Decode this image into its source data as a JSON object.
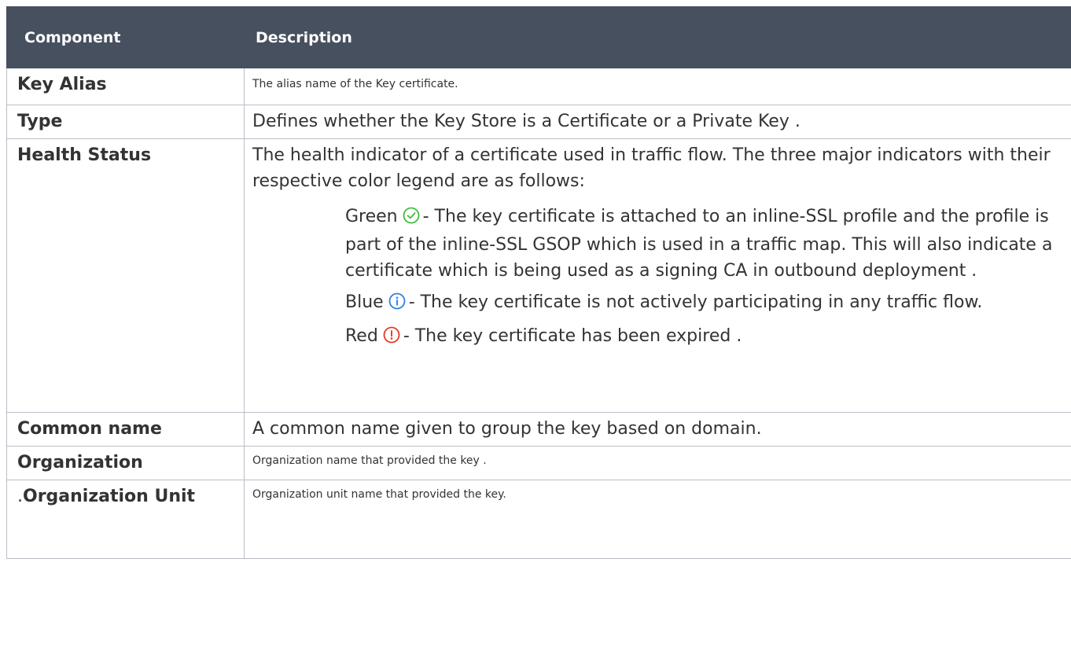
{
  "headers": {
    "component": "Component",
    "description": "Description"
  },
  "rows": [
    {
      "component": "Key Alias",
      "description": "The alias name of the Key certificate."
    },
    {
      "component": "Type",
      "description": "Defines whether the Key Store is a Certificate or a Private Key ."
    },
    {
      "component": "Health Status",
      "description": "The health indicator of a certificate used in traffic flow. The three major indicators with their respective color legend are as follows:",
      "indicators": [
        {
          "color_name": "Green",
          "icon": "check-circle-icon",
          "color": "#3fbf3f",
          "text": "- The key certificate is attached to an inline-SSL profile and the profile is part of the inline-SSL GSOP which is used in a traffic map. This will also indicate a certificate which is being used as a signing CA in outbound deployment ."
        },
        {
          "color_name": "Blue",
          "icon": "info-circle-icon",
          "color": "#2f7fe6",
          "text": "- The key certificate is not actively participating in any traffic flow."
        },
        {
          "color_name": "Red",
          "icon": "exclamation-circle-icon",
          "color": "#e03b24",
          "text": "- The key certificate has been expired ."
        }
      ]
    },
    {
      "component": "Common name",
      "description": "A common name given to group the key based on domain."
    },
    {
      "component": "Organization",
      "description": "Organization name that provided the key ."
    },
    {
      "component_prefix": ".",
      "component": "Organization Unit",
      "description": "Organization unit name that provided the key."
    }
  ]
}
